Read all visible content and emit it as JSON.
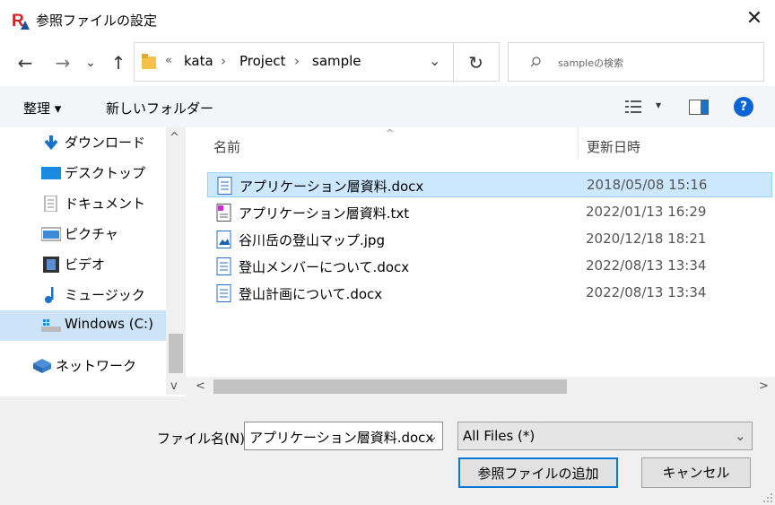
{
  "window": {
    "title": "参照ファイルの設定",
    "close_glyph": "✕",
    "logo_text": "R"
  },
  "nav": {
    "back": "←",
    "forward": "→",
    "history": "⌄",
    "up": "↑",
    "refresh": "↻",
    "breadcrumb": {
      "overflow": "«",
      "parts": [
        "kata",
        "Project",
        "sample"
      ],
      "sep": "›"
    },
    "search_placeholder": "sampleの検索",
    "dropdown": "⌄"
  },
  "toolbar": {
    "organize": "整理 ▾",
    "new_folder": "新しいフォルダー",
    "view_chevron": "▾",
    "help": "?"
  },
  "sidebar": {
    "items": [
      {
        "label": "ダウンロード",
        "icon": "download-arrow-icon"
      },
      {
        "label": "デスクトップ",
        "icon": "desktop-icon"
      },
      {
        "label": "ドキュメント",
        "icon": "document-icon"
      },
      {
        "label": "ピクチャ",
        "icon": "picture-icon"
      },
      {
        "label": "ビデオ",
        "icon": "video-icon"
      },
      {
        "label": "ミュージック",
        "icon": "music-icon"
      },
      {
        "label": "Windows (C:)",
        "icon": "drive-icon",
        "selected": true
      },
      {
        "label": "ネットワーク",
        "icon": "network-icon"
      }
    ],
    "scroll_up": "^",
    "scroll_down": "v"
  },
  "filelist": {
    "columns": [
      "名前",
      "更新日時"
    ],
    "rows": [
      {
        "name": "アプリケーション層資料.docx",
        "date": "2018/05/08 15:16",
        "type": "docx",
        "selected": true
      },
      {
        "name": "アプリケーション層資料.txt",
        "date": "2022/01/13 16:29",
        "type": "txt"
      },
      {
        "name": "谷川岳の登山マップ.jpg",
        "date": "2020/12/18 18:21",
        "type": "jpg"
      },
      {
        "name": "登山メンバーについて.docx",
        "date": "2022/08/13 13:34",
        "type": "docx"
      },
      {
        "name": "登山計画について.docx",
        "date": "2022/08/13 13:34",
        "type": "docx"
      }
    ],
    "scroll_left": "<",
    "scroll_right": ">"
  },
  "bottom": {
    "filename_label": "ファイル名(N):",
    "filename_value": "アプリケーション層資料.docx",
    "filetype_value": "All Files (*)",
    "add_button": "参照ファイルの追加",
    "cancel_button": "キャンセル"
  },
  "colors": {
    "selection": "#cce8ff",
    "accent": "#0078d7",
    "help": "#0a64d6"
  }
}
